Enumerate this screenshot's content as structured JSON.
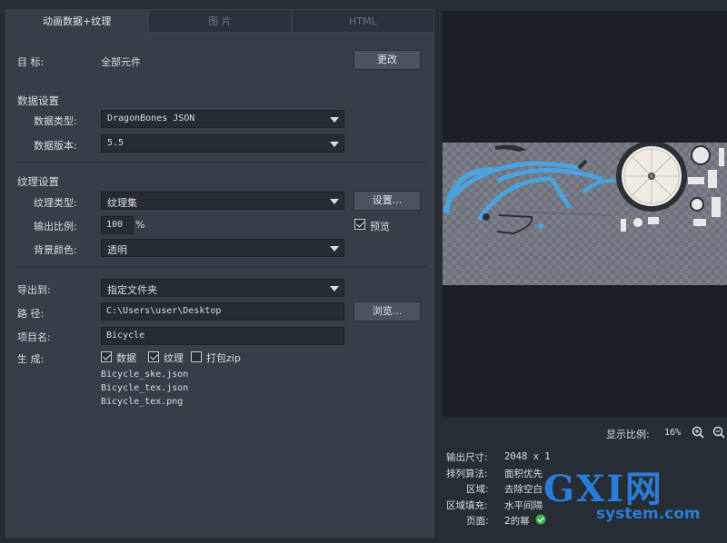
{
  "tabs": [
    "动画数据+纹理",
    "图 片",
    "HTML"
  ],
  "target": {
    "label": "目  标:",
    "value": "全部元件",
    "change_button": "更改"
  },
  "data_settings": {
    "title": "数据设置",
    "type_label": "数据类型:",
    "type_value": "DragonBones JSON",
    "version_label": "数据版本:",
    "version_value": "5.5"
  },
  "texture_settings": {
    "title": "纹理设置",
    "type_label": "纹理类型:",
    "type_value": "纹理集",
    "settings_button": "设置...",
    "scale_label": "输出比例:",
    "scale_value": "100",
    "scale_unit": "%",
    "preview_label": "预览",
    "bg_label": "背景颜色:",
    "bg_value": "透明"
  },
  "export": {
    "to_label": "导出到:",
    "to_value": "指定文件夹",
    "path_label": "路  径:",
    "path_value": "C:\\Users\\user\\Desktop",
    "browse_button": "浏览...",
    "project_label": "项目名:",
    "project_value": "Bicycle",
    "generate_label": "生  成:",
    "gen_data": "数据",
    "gen_texture": "纹理",
    "gen_zip": "打包zip",
    "files": [
      "Bicycle_ske.json",
      "Bicycle_tex.json",
      "Bicycle_tex.png"
    ]
  },
  "preview": {
    "zoom_label": "显示比例:",
    "zoom_value": "16%",
    "output_size_label": "输出尺寸:",
    "output_size_value": "2048 x 1",
    "algo_label": "排列算法:",
    "algo_value": "面积优先",
    "area_label": "区域:",
    "area_value": "去除空白",
    "fill_label": "区域填充:",
    "fill_value": "水平间隔",
    "page_label": "页面:",
    "page_value": "2的幂"
  },
  "watermark": {
    "brand": "GXI网",
    "site": "system.com"
  },
  "colors": {
    "accent": "#4aa3df",
    "bg": "#272d35",
    "panel": "#363e48",
    "watermark": "#2a7cd6"
  }
}
